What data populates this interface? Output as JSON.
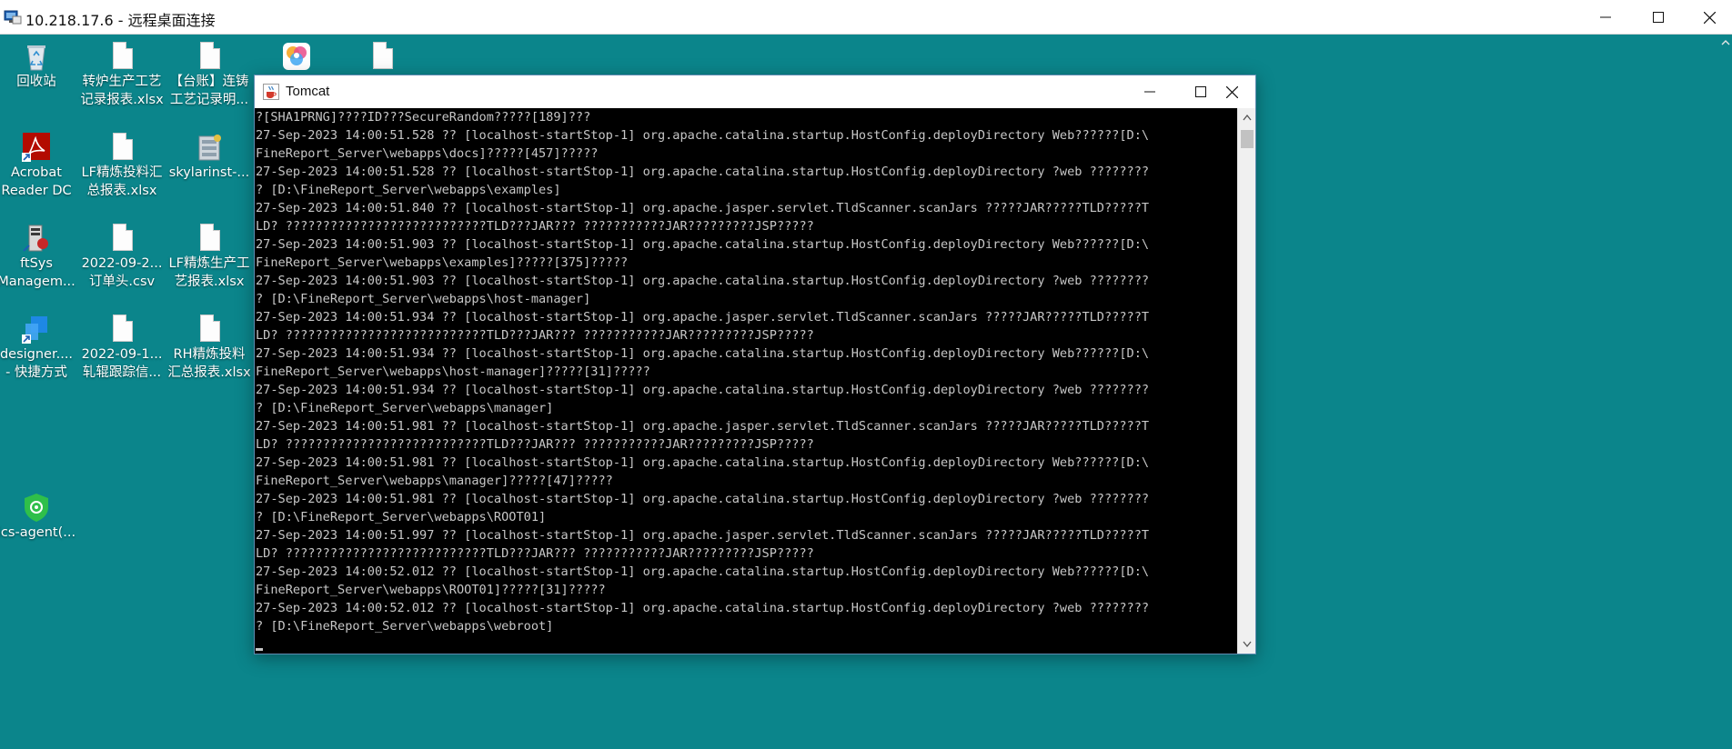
{
  "rdp": {
    "title": "10.218.17.6 - 远程桌面连接",
    "icon": "remote-desktop-icon",
    "controls": [
      "minimize",
      "maximize",
      "close"
    ]
  },
  "desktop": {
    "icons": [
      {
        "name": "recycle-bin",
        "label": "回收站",
        "icon": "recycle-bin-icon"
      },
      {
        "name": "converter-process-xlsx",
        "label": "转炉生产工艺\n记录报表.xlsx",
        "icon": "document-icon"
      },
      {
        "name": "ledger-casting-file",
        "label": "【台账】连铸\n工艺记录明...",
        "icon": "document-icon"
      },
      {
        "name": "color-app",
        "label": "",
        "icon": "color-wheel-icon"
      },
      {
        "name": "blank-doc",
        "label": "",
        "icon": "document-icon"
      },
      {
        "name": "acrobat-reader",
        "label": "Acrobat\nReader DC",
        "icon": "acrobat-icon"
      },
      {
        "name": "lf-refining-summary",
        "label": "LF精炼投料汇\n总报表.xlsx",
        "icon": "document-icon"
      },
      {
        "name": "skylarinst",
        "label": "skylarinst-...",
        "icon": "installer-icon"
      },
      {
        "name": "ftsys-management",
        "label": "ftSys\nManagem...",
        "icon": "ftsys-icon"
      },
      {
        "name": "order-head-csv",
        "label": "2022-09-2...\n订单头.csv",
        "icon": "document-icon"
      },
      {
        "name": "lf-production-report",
        "label": "LF精炼生产工\n艺报表.xlsx",
        "icon": "document-icon"
      },
      {
        "name": "designer-shortcut",
        "label": "designer....\n- 快捷方式",
        "icon": "designer-icon"
      },
      {
        "name": "roll-tracking",
        "label": "2022-09-1...\n轧辊跟踪信...",
        "icon": "document-icon"
      },
      {
        "name": "rh-refining-summary",
        "label": "RH精炼投料\n汇总报表.xlsx",
        "icon": "document-icon"
      },
      {
        "name": "ics-agent",
        "label": "ics-agent(...",
        "icon": "shield-icon"
      }
    ]
  },
  "tomcat": {
    "title": "Tomcat",
    "icon": "java-cup-icon",
    "controls": [
      "minimize",
      "maximize",
      "close"
    ],
    "lines": [
      "?[SHA1PRNG]????ID???SecureRandom?????[189]???",
      "27-Sep-2023 14:00:51.528 ?? [localhost-startStop-1] org.apache.catalina.startup.HostConfig.deployDirectory Web??????[D:\\",
      "FineReport_Server\\webapps\\docs]?????[457]?????",
      "27-Sep-2023 14:00:51.528 ?? [localhost-startStop-1] org.apache.catalina.startup.HostConfig.deployDirectory ?web ????????",
      "? [D:\\FineReport_Server\\webapps\\examples]",
      "27-Sep-2023 14:00:51.840 ?? [localhost-startStop-1] org.apache.jasper.servlet.TldScanner.scanJars ?????JAR?????TLD?????T",
      "LD? ???????????????????????????TLD???JAR??? ???????????JAR?????????JSP?????",
      "27-Sep-2023 14:00:51.903 ?? [localhost-startStop-1] org.apache.catalina.startup.HostConfig.deployDirectory Web??????[D:\\",
      "FineReport_Server\\webapps\\examples]?????[375]?????",
      "27-Sep-2023 14:00:51.903 ?? [localhost-startStop-1] org.apache.catalina.startup.HostConfig.deployDirectory ?web ????????",
      "? [D:\\FineReport_Server\\webapps\\host-manager]",
      "27-Sep-2023 14:00:51.934 ?? [localhost-startStop-1] org.apache.jasper.servlet.TldScanner.scanJars ?????JAR?????TLD?????T",
      "LD? ???????????????????????????TLD???JAR??? ???????????JAR?????????JSP?????",
      "27-Sep-2023 14:00:51.934 ?? [localhost-startStop-1] org.apache.catalina.startup.HostConfig.deployDirectory Web??????[D:\\",
      "FineReport_Server\\webapps\\host-manager]?????[31]?????",
      "27-Sep-2023 14:00:51.934 ?? [localhost-startStop-1] org.apache.catalina.startup.HostConfig.deployDirectory ?web ????????",
      "? [D:\\FineReport_Server\\webapps\\manager]",
      "27-Sep-2023 14:00:51.981 ?? [localhost-startStop-1] org.apache.jasper.servlet.TldScanner.scanJars ?????JAR?????TLD?????T",
      "LD? ???????????????????????????TLD???JAR??? ???????????JAR?????????JSP?????",
      "27-Sep-2023 14:00:51.981 ?? [localhost-startStop-1] org.apache.catalina.startup.HostConfig.deployDirectory Web??????[D:\\",
      "FineReport_Server\\webapps\\manager]?????[47]?????",
      "27-Sep-2023 14:00:51.981 ?? [localhost-startStop-1] org.apache.catalina.startup.HostConfig.deployDirectory ?web ????????",
      "? [D:\\FineReport_Server\\webapps\\ROOT01]",
      "27-Sep-2023 14:00:51.997 ?? [localhost-startStop-1] org.apache.jasper.servlet.TldScanner.scanJars ?????JAR?????TLD?????T",
      "LD? ???????????????????????????TLD???JAR??? ???????????JAR?????????JSP?????",
      "27-Sep-2023 14:00:52.012 ?? [localhost-startStop-1] org.apache.catalina.startup.HostConfig.deployDirectory Web??????[D:\\",
      "FineReport_Server\\webapps\\ROOT01]?????[31]?????",
      "27-Sep-2023 14:00:52.012 ?? [localhost-startStop-1] org.apache.catalina.startup.HostConfig.deployDirectory ?web ????????",
      "? [D:\\FineReport_Server\\webapps\\webroot]"
    ]
  },
  "colors": {
    "desktop": "#0b858b",
    "console_bg": "#000000",
    "console_text": "#c7c7c7",
    "window_border": "#5f8cb1"
  }
}
